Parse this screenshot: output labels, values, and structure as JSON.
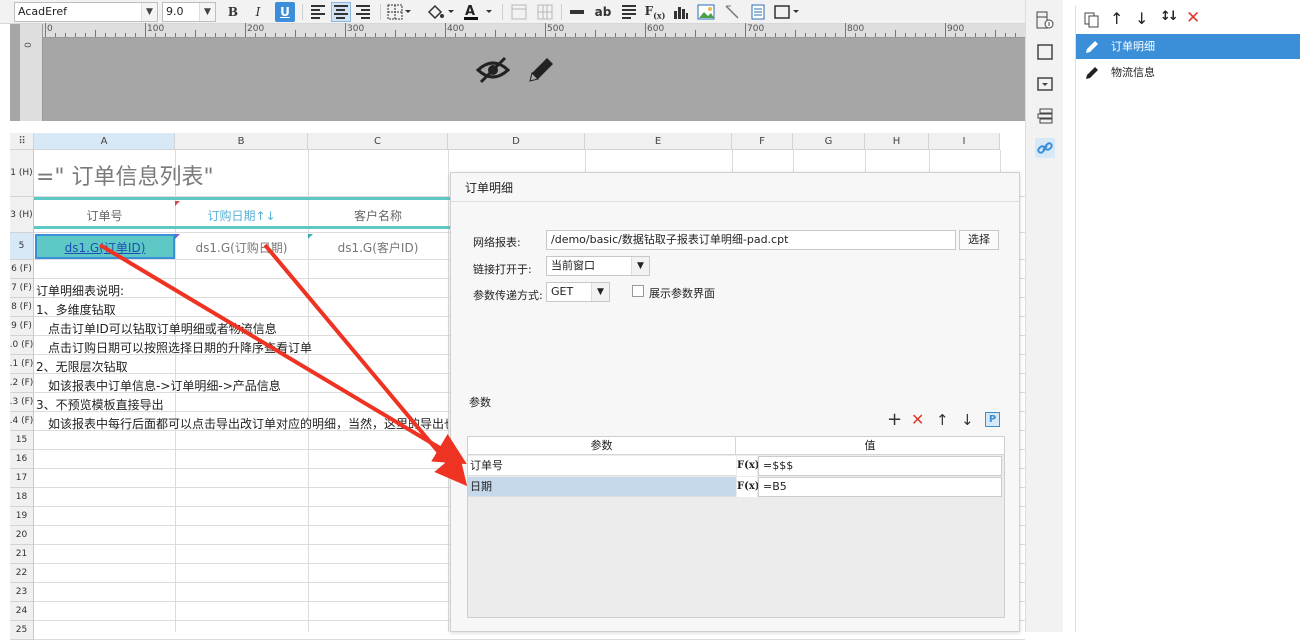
{
  "toolbar": {
    "font_name": "AcadEref",
    "font_size": "9.0",
    "bold": "B",
    "italic": "I",
    "underline": "U",
    "text_tool": "ab"
  },
  "ruler": {
    "labels": [
      "0",
      "100",
      "200",
      "300",
      "400",
      "500",
      "600",
      "700",
      "800",
      "900"
    ],
    "v_label": "0"
  },
  "grid": {
    "columns": [
      "A",
      "B",
      "C",
      "D",
      "E",
      "F",
      "G",
      "H",
      "I"
    ],
    "rows": [
      {
        "label": "1 (H)"
      },
      {
        "label": "3 (H)"
      },
      {
        "label": "5"
      },
      {
        "label": "6 (F)"
      },
      {
        "label": "7 (F)"
      },
      {
        "label": "8 (F)"
      },
      {
        "label": "9 (F)"
      },
      {
        "label": ".0 (F)"
      },
      {
        "label": ".1 (F)"
      },
      {
        "label": ".2 (F)"
      },
      {
        "label": ".3 (F)"
      },
      {
        "label": ".4 (F)"
      },
      {
        "label": "15"
      },
      {
        "label": "16"
      },
      {
        "label": "17"
      },
      {
        "label": "18"
      },
      {
        "label": "19"
      },
      {
        "label": "20"
      },
      {
        "label": "21"
      },
      {
        "label": "22"
      },
      {
        "label": "23"
      },
      {
        "label": "24"
      },
      {
        "label": "25"
      }
    ],
    "title": "=\"  订单信息列表\"",
    "header_cells": [
      "订单号",
      "订购日期↑↓",
      "客户名称"
    ],
    "data_cells": [
      "ds1.G(订单ID)",
      "ds1.G(订购日期)",
      "ds1.G(客户ID)"
    ],
    "notes": [
      "订单明细表说明:",
      "1、多维度钻取",
      "点击订单ID可以钻取订单明细或者物流信息",
      "点击订购日期可以按照选择日期的升降序查看订单",
      "2、无限层次钻取",
      "如该报表中订单信息->订单明细->产品信息",
      "3、不预览模板直接导出",
      "如该报表中每行后面都可以点击导出改订单对应的明细，当然，这里的导出也"
    ]
  },
  "dialog": {
    "title": "订单明细",
    "report_label": "网络报表:",
    "report_path": "/demo/basic/数据钻取子报表订单明细-pad.cpt",
    "select_button": "选择",
    "open_in_label": "链接打开于:",
    "open_in_value": "当前窗口",
    "method_label": "参数传递方式:",
    "method_value": "GET",
    "show_params_label": "展示参数界面",
    "params_section": "参数",
    "param_col_name": "参数",
    "param_col_value": "值",
    "params": [
      {
        "name": "订单号",
        "formula_icon": "F(x)",
        "value": "=$$$"
      },
      {
        "name": "日期",
        "formula_icon": "F(x)",
        "value": "=B5"
      }
    ]
  },
  "hyperlinks": [
    {
      "label": "订单明细",
      "selected": true
    },
    {
      "label": "物流信息",
      "selected": false
    }
  ],
  "colors": {
    "accent": "#3b8fd9",
    "selected_row": "#c5d9ea",
    "teal": "#5ec9c4",
    "arrow": "#ee3322"
  }
}
